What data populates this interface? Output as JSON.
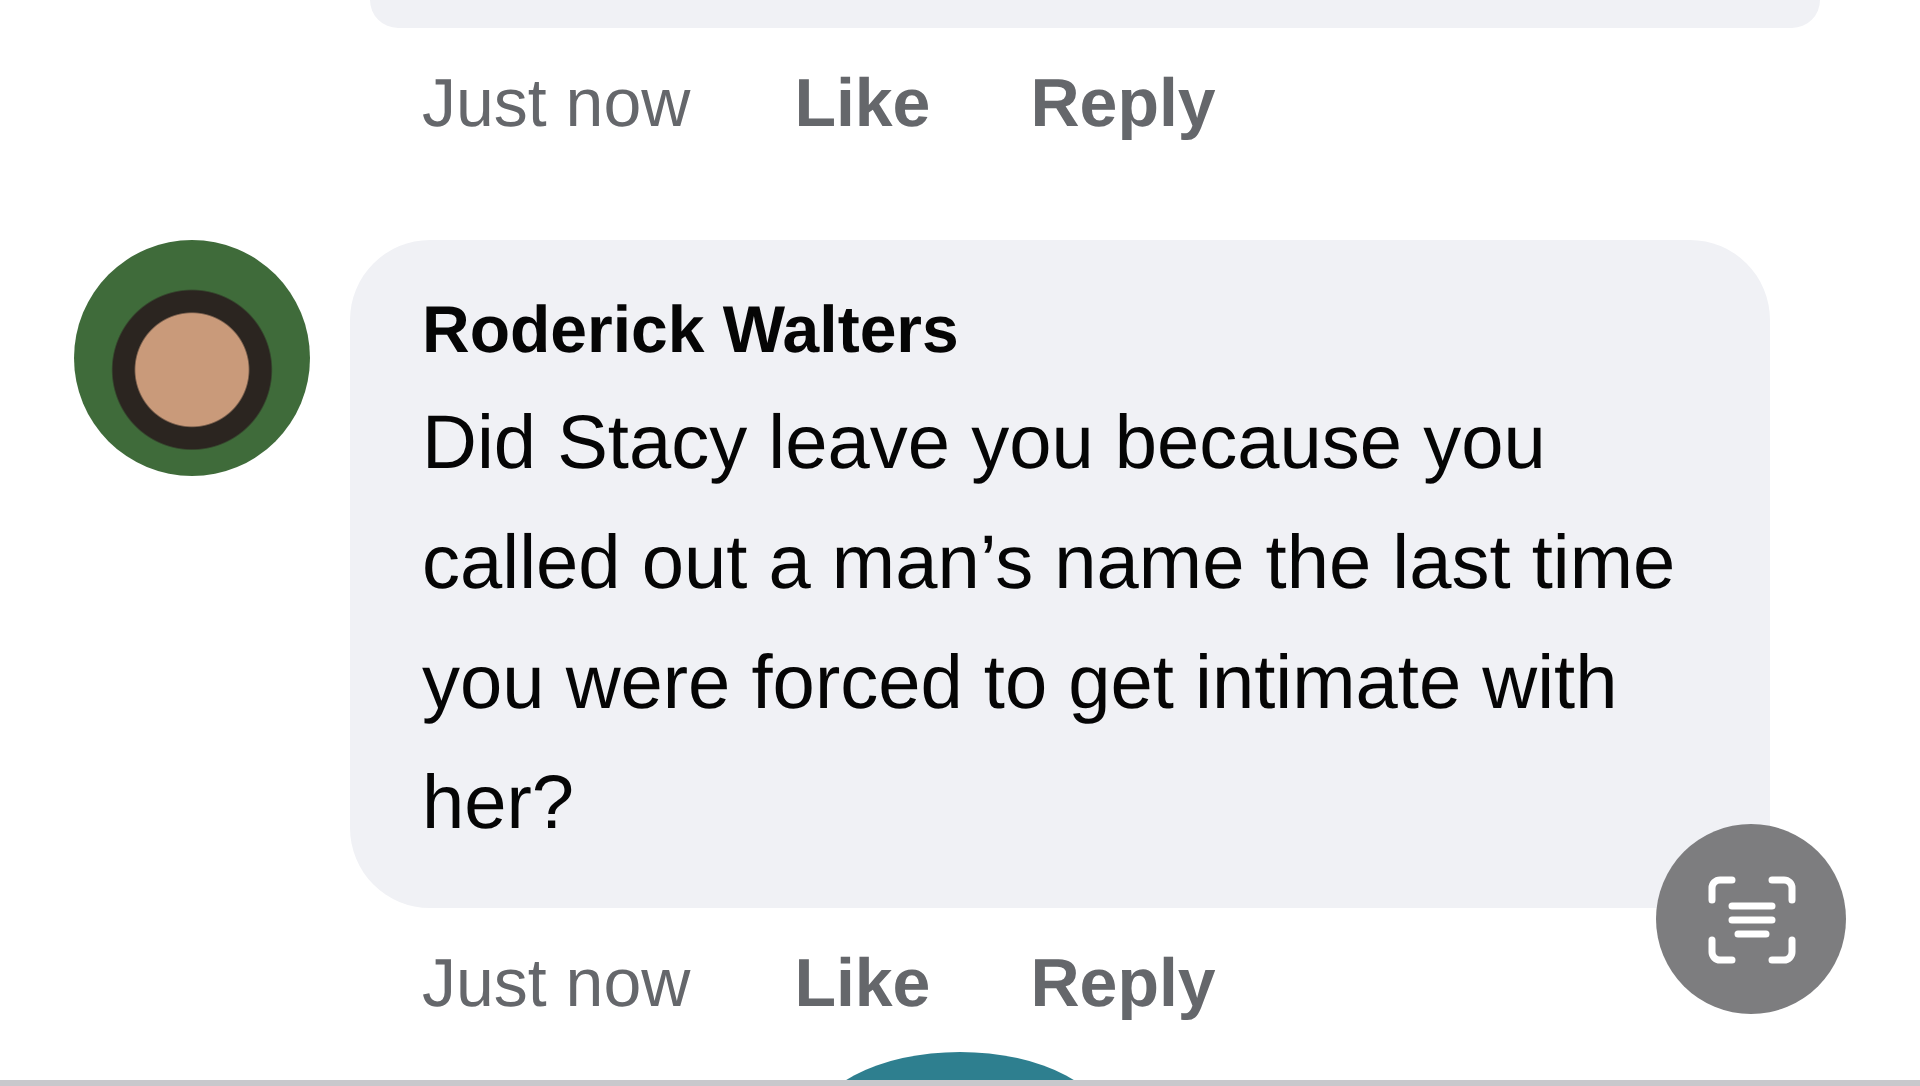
{
  "previous_comment": {
    "time": "Just now",
    "actions": [
      "Like",
      "Reply"
    ]
  },
  "comment": {
    "author": "Roderick Walters",
    "text": "Did Stacy leave you because you called out a man’s name the last time you were forced to get intimate with her?",
    "time": "Just now",
    "actions": [
      "Like",
      "Reply"
    ]
  }
}
